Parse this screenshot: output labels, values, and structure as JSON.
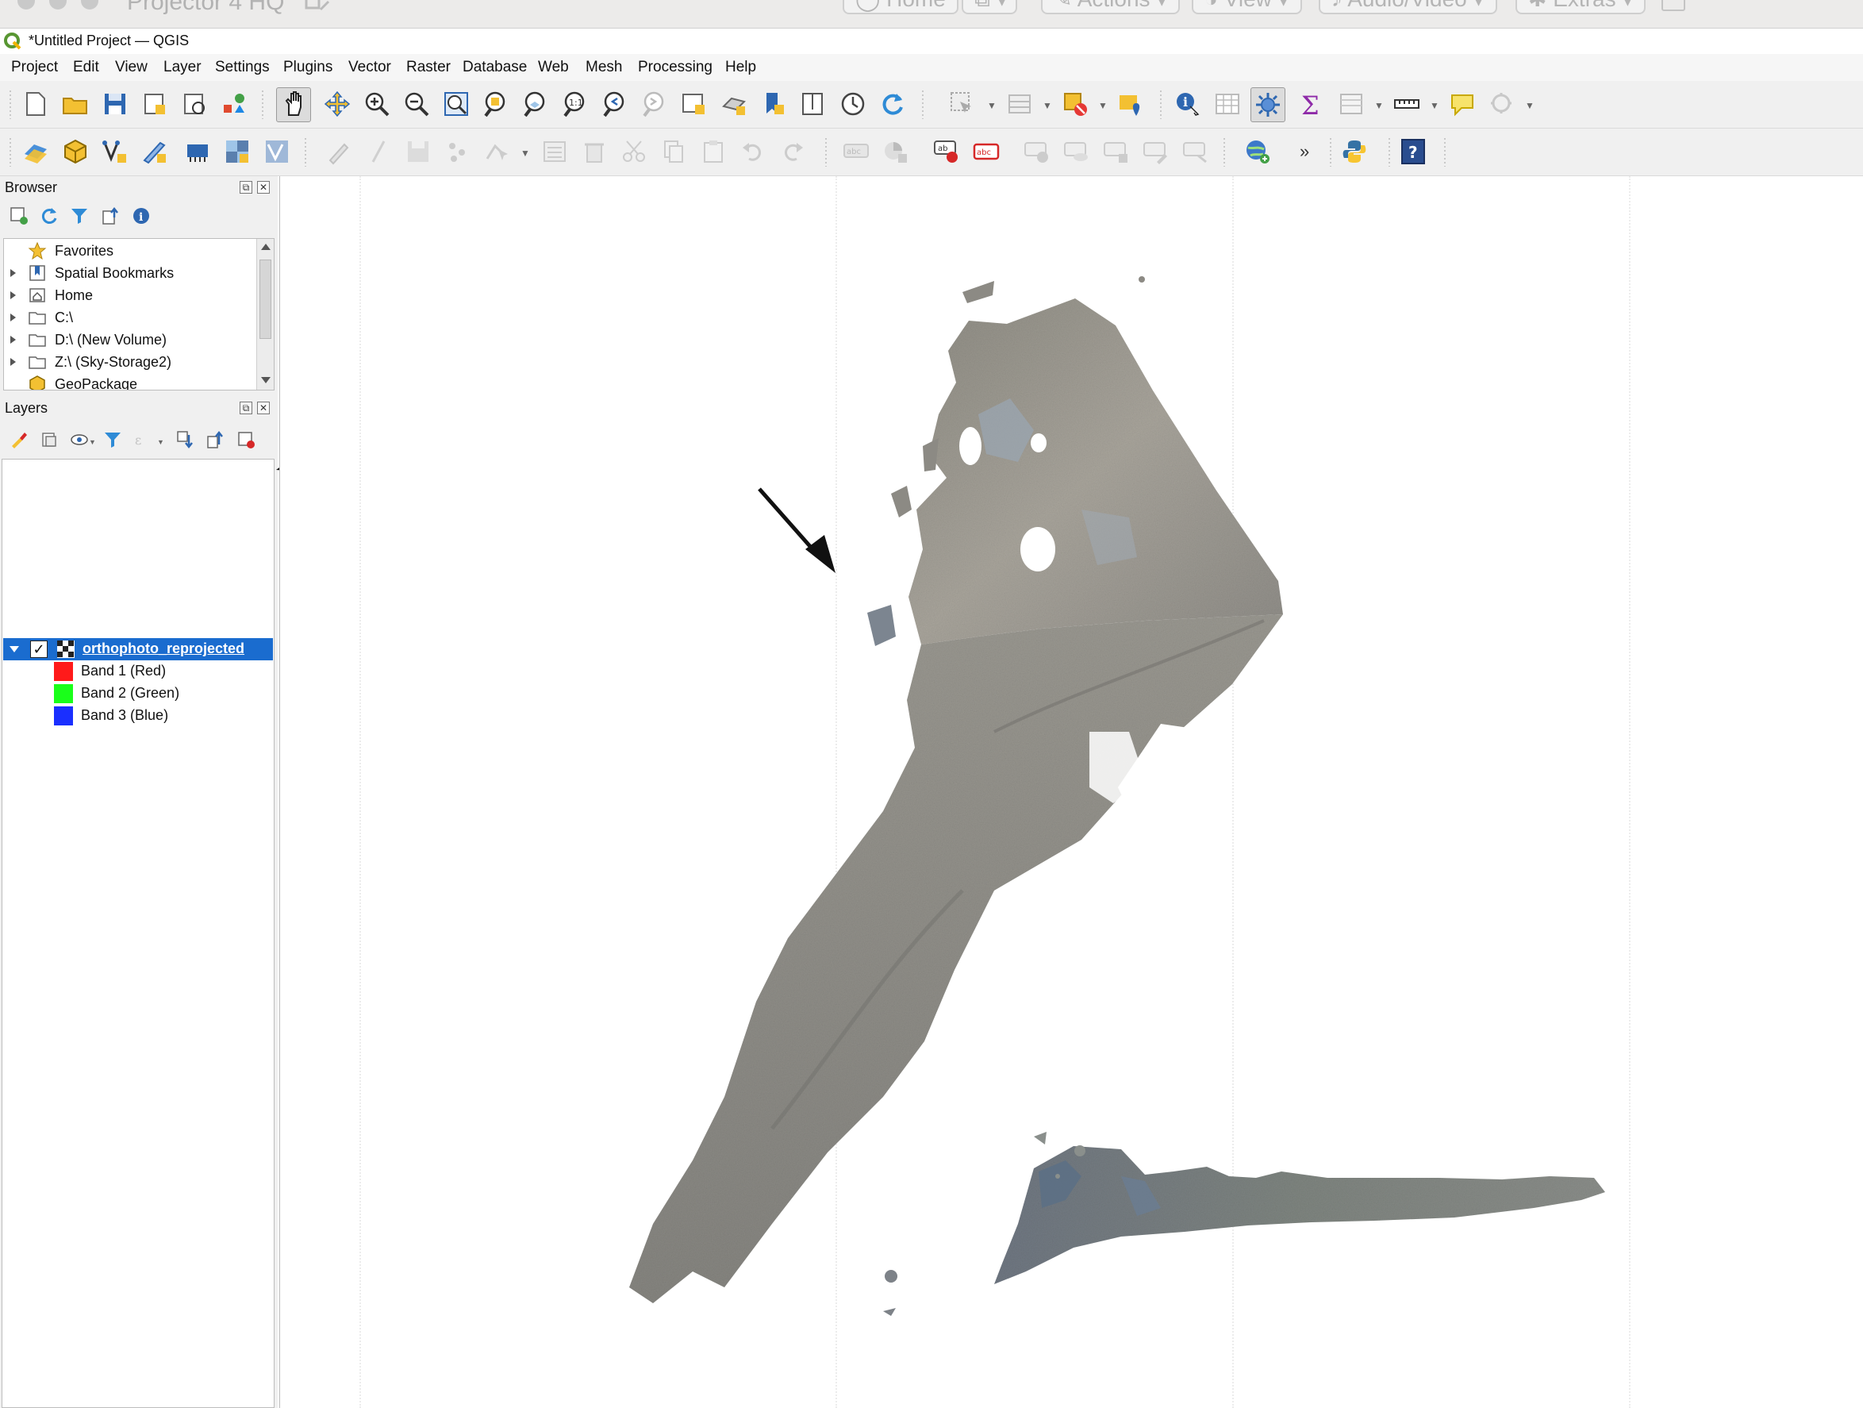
{
  "outer_window": {
    "title": "Projector 4 HQ",
    "toolbar_buttons": [
      "Home",
      "Actions",
      "View",
      "Audio/Video",
      "Extras"
    ]
  },
  "window": {
    "title": "*Untitled Project — QGIS"
  },
  "menu": {
    "items": [
      "Project",
      "Edit",
      "View",
      "Layer",
      "Settings",
      "Plugins",
      "Vector",
      "Raster",
      "Database",
      "Web",
      "Mesh",
      "Processing",
      "Help"
    ]
  },
  "toolbar": {
    "more_label": "»"
  },
  "browser": {
    "title": "Browser",
    "items": [
      {
        "label": "Favorites",
        "icon": "star-icon"
      },
      {
        "label": "Spatial Bookmarks",
        "icon": "bookmark-icon"
      },
      {
        "label": "Home",
        "icon": "home-folder-icon"
      },
      {
        "label": "C:\\",
        "icon": "folder-icon"
      },
      {
        "label": "D:\\ (New Volume)",
        "icon": "folder-icon"
      },
      {
        "label": "Z:\\ (Sky-Storage2)",
        "icon": "folder-icon"
      },
      {
        "label": "GeoPackage",
        "icon": "geopackage-icon"
      }
    ]
  },
  "layers": {
    "title": "Layers",
    "layer_name": "orthophoto_reprojected",
    "bands": [
      {
        "label": "Band 1 (Red)",
        "color": "#ff1a1a"
      },
      {
        "label": "Band 2 (Green)",
        "color": "#1aff1a"
      },
      {
        "label": "Band 3 (Blue)",
        "color": "#1a2fff"
      }
    ]
  },
  "colors": {
    "selection": "#1a6ccf",
    "annotation_arrow": "#111111"
  }
}
